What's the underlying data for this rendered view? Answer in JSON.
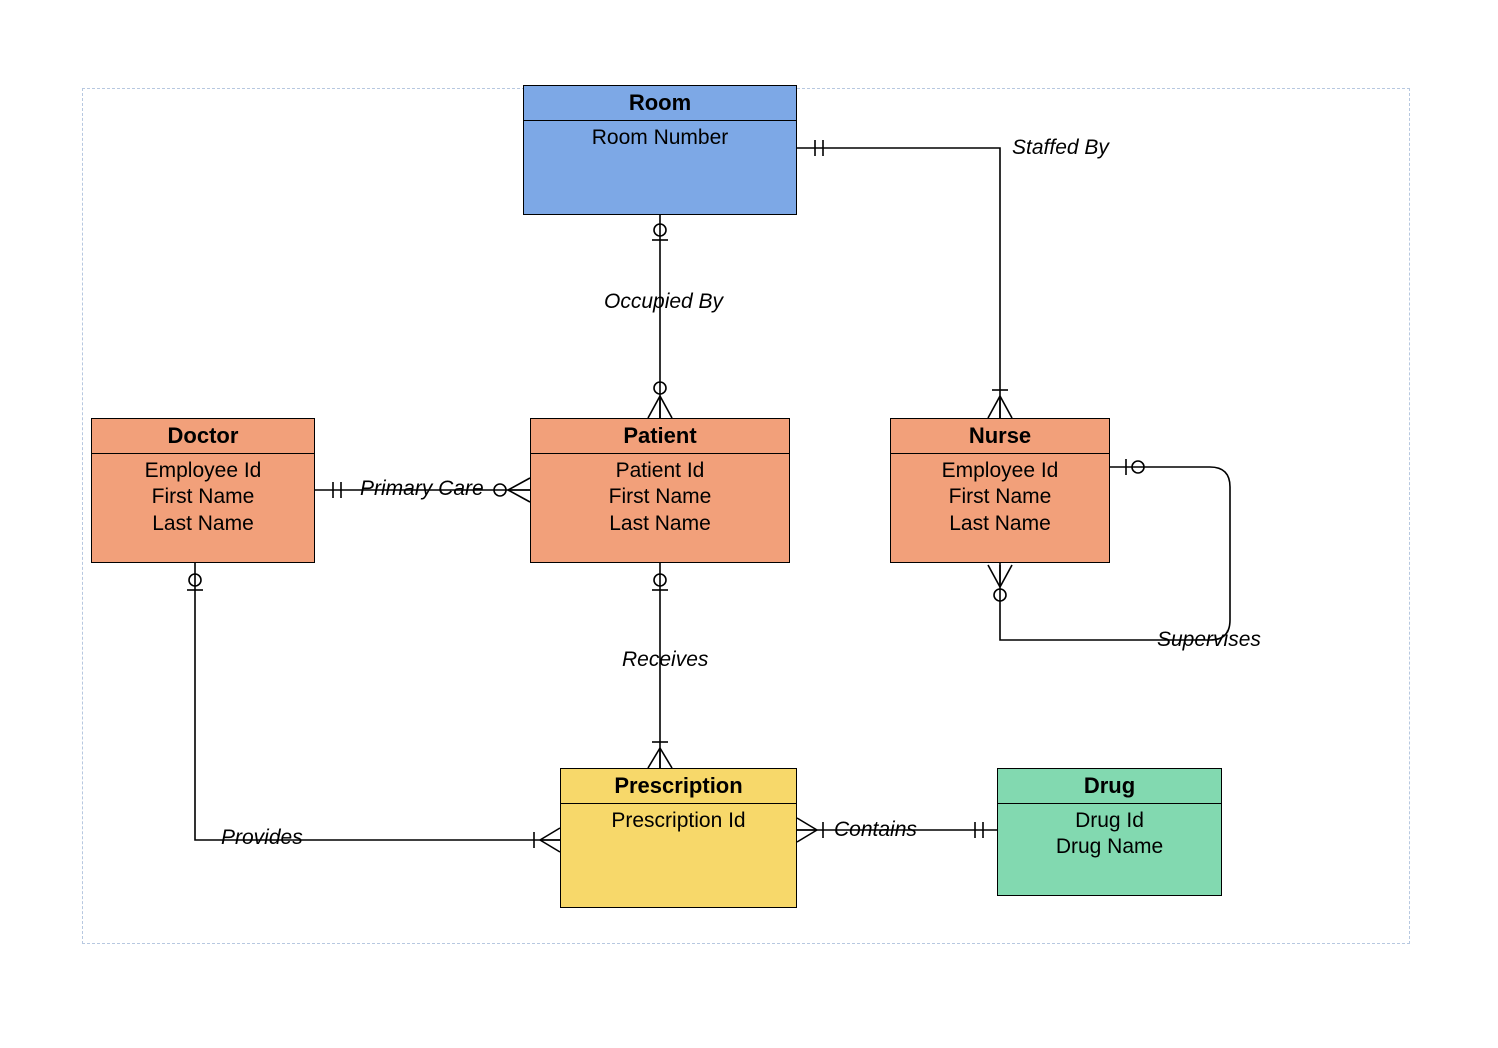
{
  "entities": {
    "room": {
      "title": "Room",
      "attrs": [
        "Room Number"
      ]
    },
    "doctor": {
      "title": "Doctor",
      "attrs": [
        "Employee Id",
        "First Name",
        "Last Name"
      ]
    },
    "patient": {
      "title": "Patient",
      "attrs": [
        "Patient Id",
        "First Name",
        "Last Name"
      ]
    },
    "nurse": {
      "title": "Nurse",
      "attrs": [
        "Employee Id",
        "First Name",
        "Last Name"
      ]
    },
    "prescription": {
      "title": "Prescription",
      "attrs": [
        "Prescription Id"
      ]
    },
    "drug": {
      "title": "Drug",
      "attrs": [
        "Drug Id",
        "Drug Name"
      ]
    }
  },
  "relationships": {
    "staffed_by": "Staffed By",
    "occupied_by": "Occupied By",
    "primary_care": "Primary Care",
    "receives": "Receives",
    "provides": "Provides",
    "contains": "Contains",
    "supervises": "Supervises"
  },
  "colors": {
    "blue": "#7da8e6",
    "orange": "#f2a07a",
    "yellow": "#f7d86a",
    "green": "#82d9b0"
  }
}
